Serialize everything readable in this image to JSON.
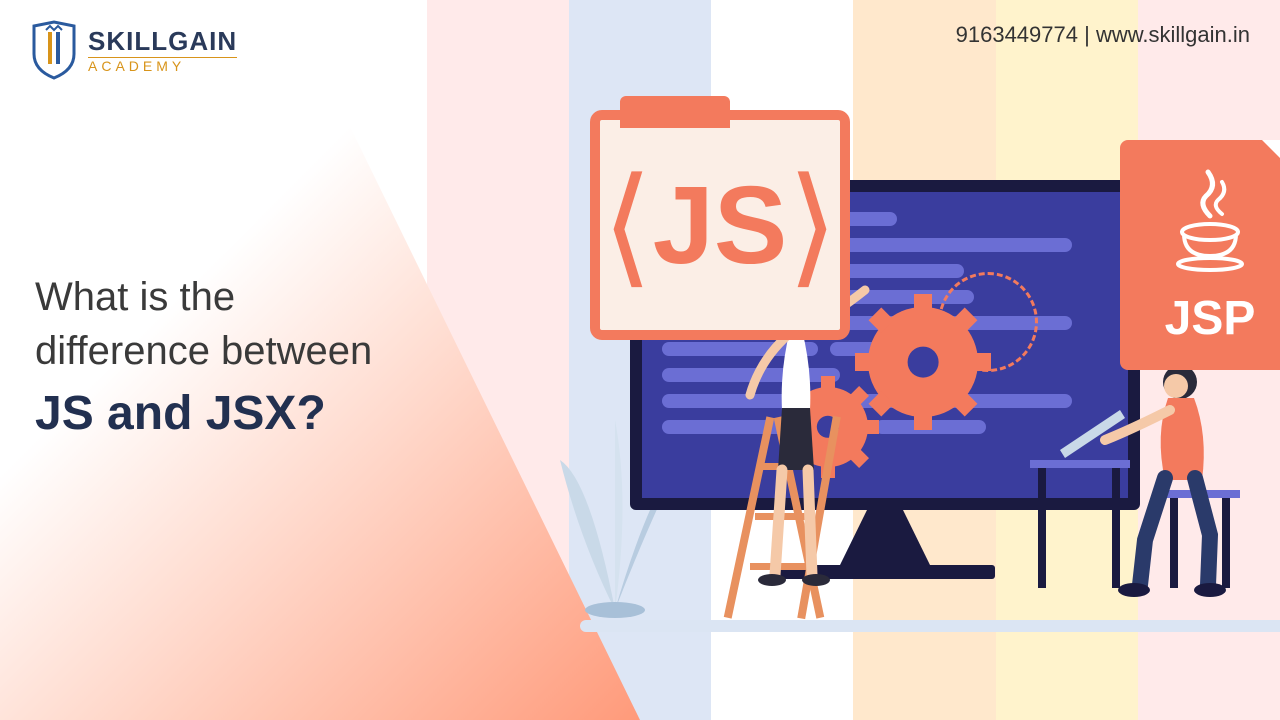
{
  "logo": {
    "main": "SKILLGAIN",
    "sub": "ACADEMY"
  },
  "contact": {
    "phone": "9163449774",
    "separator": " | ",
    "url": "www.skillgain.in"
  },
  "headline": {
    "line1": "What is the",
    "line2": "difference between",
    "emphasis": "JS and JSX?"
  },
  "cards": {
    "js_label": "JS",
    "jsp_label": "JSP"
  },
  "icons": {
    "js": "js-angle-brackets-icon",
    "java": "java-cup-icon",
    "gear": "gear-icon",
    "plant": "plant-icon"
  },
  "colors": {
    "accent": "#f37a5d",
    "navy": "#1a1a40",
    "screen": "#3a3d9e",
    "brand_dark": "#223050"
  }
}
